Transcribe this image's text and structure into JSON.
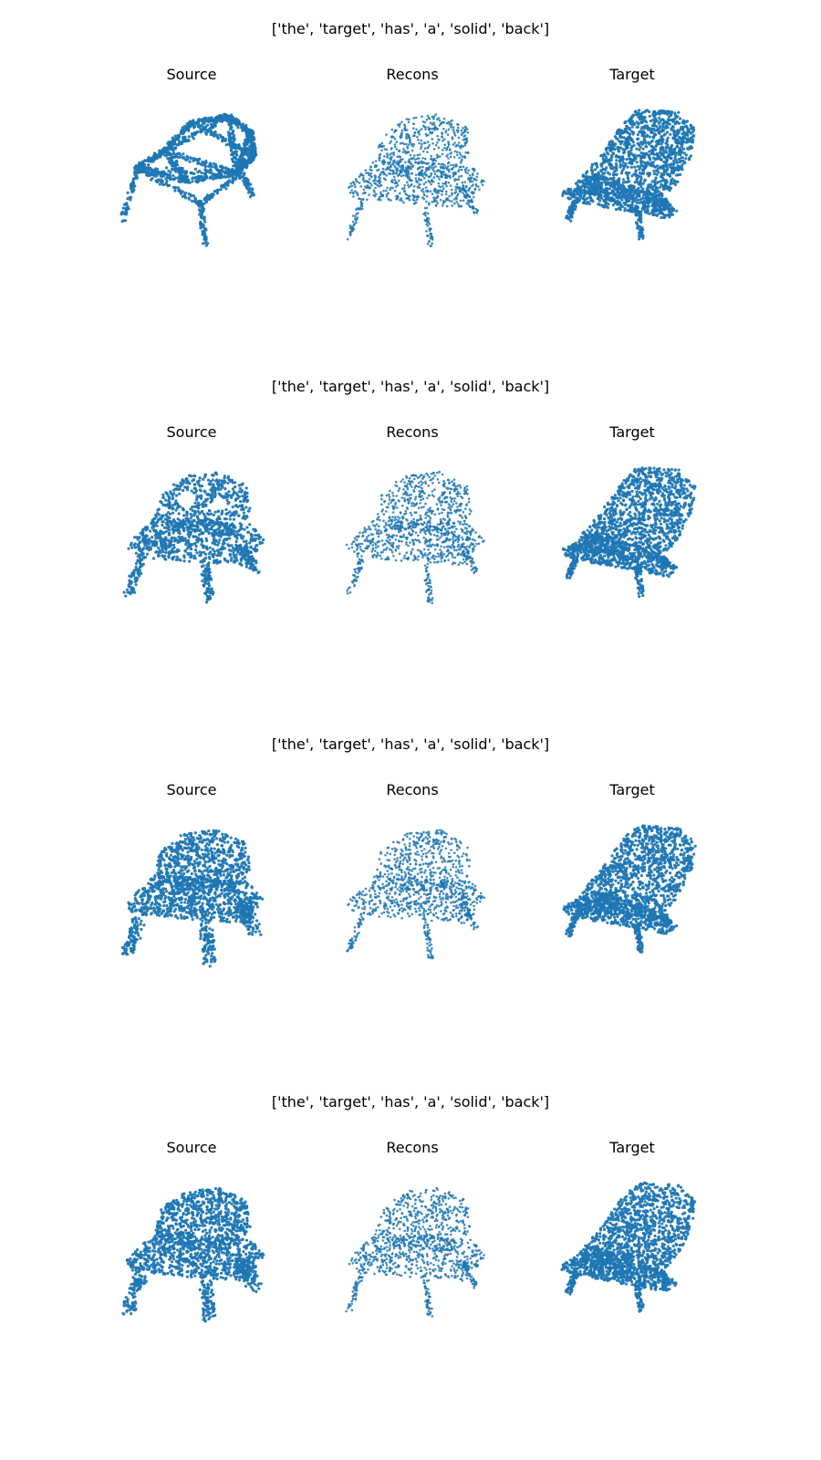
{
  "figure": {
    "rows": [
      {
        "caption": "['the', 'target', 'has', 'a', 'solid', 'back']",
        "panels": [
          {
            "title": "Source",
            "shape": "wire-frame-chair"
          },
          {
            "title": "Recons",
            "shape": "sparse-chair"
          },
          {
            "title": "Target",
            "shape": "solid-armchair"
          }
        ]
      },
      {
        "caption": "['the', 'target', 'has', 'a', 'solid', 'back']",
        "panels": [
          {
            "title": "Source",
            "shape": "holey-chair"
          },
          {
            "title": "Recons",
            "shape": "sparse-chair"
          },
          {
            "title": "Target",
            "shape": "solid-armchair"
          }
        ]
      },
      {
        "caption": "['the', 'target', 'has', 'a', 'solid', 'back']",
        "panels": [
          {
            "title": "Source",
            "shape": "blob-chair"
          },
          {
            "title": "Recons",
            "shape": "sparse-chair"
          },
          {
            "title": "Target",
            "shape": "solid-armchair"
          }
        ]
      },
      {
        "caption": "['the', 'target', 'has', 'a', 'solid', 'back']",
        "panels": [
          {
            "title": "Source",
            "shape": "blob-chair"
          },
          {
            "title": "Recons",
            "shape": "sparse-chair"
          },
          {
            "title": "Target",
            "shape": "solid-armchair"
          }
        ]
      }
    ],
    "point_color": "#1f77b4"
  }
}
